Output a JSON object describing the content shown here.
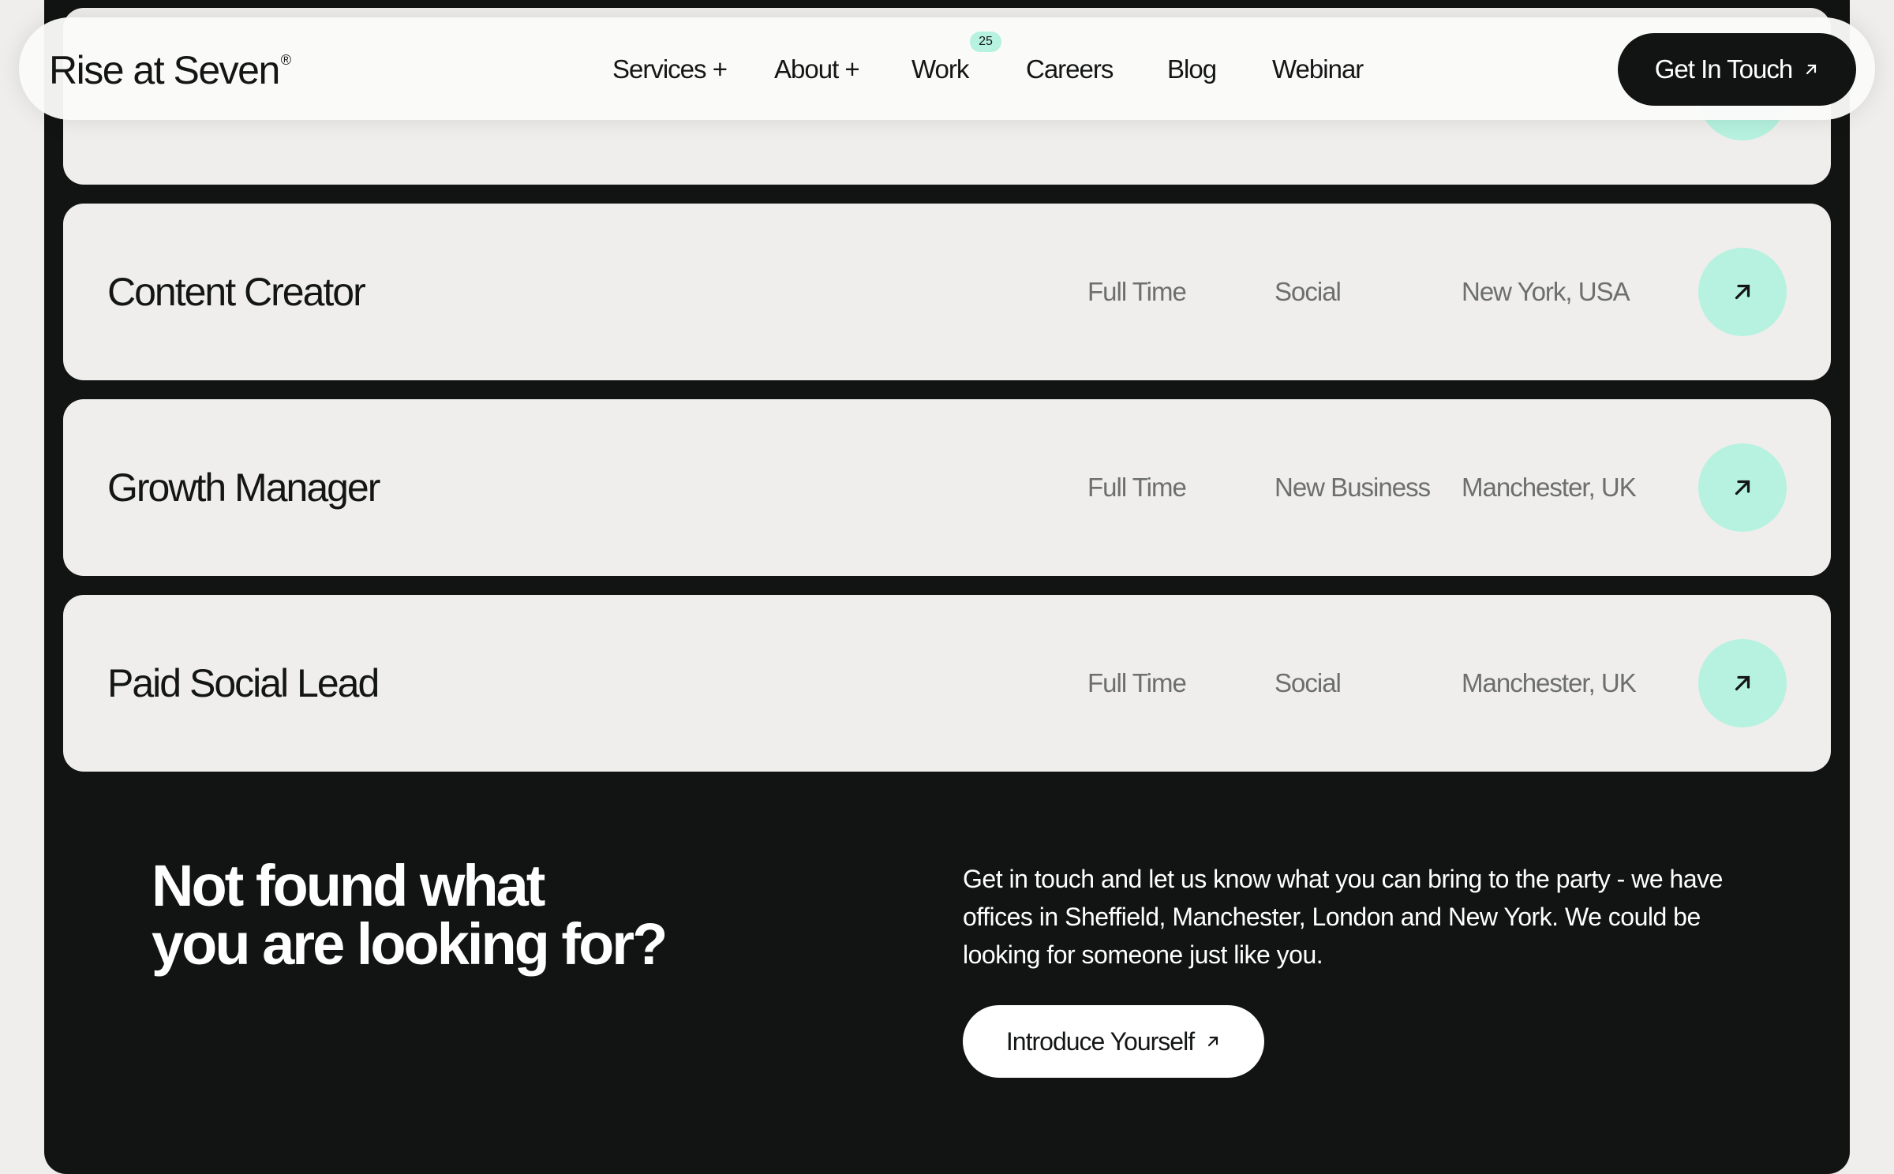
{
  "header": {
    "logo_text": "Rise at Seven",
    "logo_mark": "®",
    "nav": [
      {
        "label": "Services +"
      },
      {
        "label": "About +"
      },
      {
        "label": "Work",
        "badge": "25"
      },
      {
        "label": "Careers"
      },
      {
        "label": "Blog"
      },
      {
        "label": "Webinar"
      }
    ],
    "cta_label": "Get In Touch",
    "cta_icon": "arrow-up-right-icon"
  },
  "jobs": [
    {
      "title": "",
      "type": "",
      "department": "",
      "location": ""
    },
    {
      "title": "Content Creator",
      "type": "Full Time",
      "department": "Social",
      "location": "New York, USA"
    },
    {
      "title": "Growth Manager",
      "type": "Full Time",
      "department": "New Business",
      "location": "Manchester, UK"
    },
    {
      "title": "Paid Social Lead",
      "type": "Full Time",
      "department": "Social",
      "location": "Manchester, UK"
    }
  ],
  "not_found": {
    "heading_line1": "Not found what",
    "heading_line2": "you are looking for?",
    "text": "Get in touch and let us know what you can bring to the party - we have offices in Sheffield, Manchester, London and New York. We could be looking for someone just like you.",
    "button_label": "Introduce Yourself"
  },
  "colors": {
    "accent": "#b6f2df",
    "panel": "#121413",
    "card": "#efeeec",
    "muted_text": "#6d6f6e"
  }
}
